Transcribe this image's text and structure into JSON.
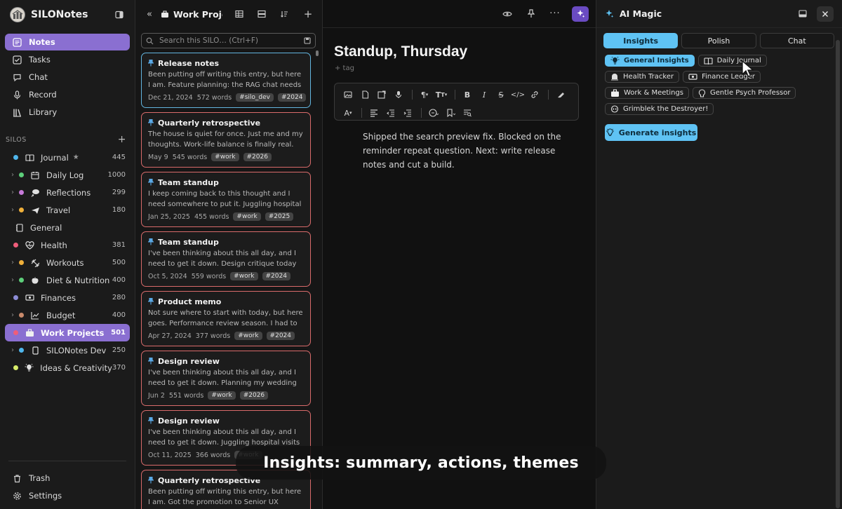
{
  "sidebar": {
    "app_title": "SILONotes",
    "nav": [
      {
        "label": "Notes",
        "icon": "notes-icon",
        "active": true
      },
      {
        "label": "Tasks",
        "icon": "checkbox-icon"
      },
      {
        "label": "Chat",
        "icon": "chat-icon"
      },
      {
        "label": "Record",
        "icon": "microphone-icon"
      },
      {
        "label": "Library",
        "icon": "library-icon"
      }
    ],
    "silos_label": "SILOS",
    "silos": [
      {
        "label": "Journal",
        "count": "445",
        "dot": "#4fb6ec",
        "icon": "book-icon",
        "star": true
      },
      {
        "label": "Daily Log",
        "count": "1000",
        "dot": "#5dcf7a",
        "icon": "calendar-icon",
        "child": true
      },
      {
        "label": "Reflections",
        "count": "299",
        "dot": "#c77ad9",
        "icon": "thought-icon",
        "child": true
      },
      {
        "label": "Travel",
        "count": "180",
        "dot": "#f0b03a",
        "icon": "plane-icon",
        "child": true
      },
      {
        "label": "General",
        "count": "",
        "dot": "",
        "icon": "notebook-icon"
      },
      {
        "label": "Health",
        "count": "381",
        "dot": "#ef5d7a",
        "icon": "heart-icon"
      },
      {
        "label": "Workouts",
        "count": "500",
        "dot": "#f0b03a",
        "icon": "dumbbell-icon",
        "child": true
      },
      {
        "label": "Diet & Nutrition",
        "count": "400",
        "dot": "#5dcf7a",
        "icon": "apple-icon",
        "child": true
      },
      {
        "label": "Finances",
        "count": "280",
        "dot": "#8c8cd6",
        "icon": "cash-icon"
      },
      {
        "label": "Budget",
        "count": "400",
        "dot": "#c98a6b",
        "icon": "chart-icon",
        "child": true
      },
      {
        "label": "Work Projects",
        "count": "501",
        "dot": "#ef5d7a",
        "icon": "briefcase-icon",
        "active": true
      },
      {
        "label": "SILONotes Dev",
        "count": "250",
        "dot": "#4fb6ec",
        "icon": "phone-icon",
        "child": true
      },
      {
        "label": "Ideas & Creativity",
        "count": "370",
        "dot": "#d8ec6a",
        "icon": "bulb-icon"
      }
    ],
    "bottom": [
      {
        "label": "Trash",
        "icon": "trash-icon"
      },
      {
        "label": "Settings",
        "icon": "gear-icon"
      }
    ]
  },
  "notes_list": {
    "title": "Work Projects",
    "search_placeholder": "Search this SILO… (Ctrl+F)",
    "cards": [
      {
        "title": "Release notes",
        "excerpt": "Been putting off writing this entry, but here I am. Feature planning: the RAG chat needs a UI...",
        "date": "Dec 21, 2024",
        "words": "572 words",
        "tags": [
          "#silo_dev",
          "#2024"
        ],
        "selected": true
      },
      {
        "title": "Quarterly retrospective",
        "excerpt": "The house is quiet for once. Just me and my thoughts. Work-life balance is finally real. I'm...",
        "date": "May 9",
        "words": "545 words",
        "tags": [
          "#work",
          "#2026"
        ]
      },
      {
        "title": "Team standup",
        "excerpt": "I keep coming back to this thought and I need somewhere to put it. Juggling hospital visits an...",
        "date": "Jan 25, 2025",
        "words": "455 words",
        "tags": [
          "#work",
          "#2025"
        ]
      },
      {
        "title": "Team standup",
        "excerpt": "I've been thinking about this all day, and I need to get it down. Design critique today was brutal in...",
        "date": "Oct 5, 2024",
        "words": "559 words",
        "tags": [
          "#work",
          "#2024"
        ]
      },
      {
        "title": "Product memo",
        "excerpt": "Not sure where to start with today, but here goes. Performance review season. I had to writ...",
        "date": "Apr 27, 2024",
        "words": "377 words",
        "tags": [
          "#work",
          "#2024"
        ]
      },
      {
        "title": "Design review",
        "excerpt": "I've been thinking about this all day, and I need to get it down. Planning my wedding leave. I want...",
        "date": "Jun 2",
        "words": "551 words",
        "tags": [
          "#work",
          "#2026"
        ]
      },
      {
        "title": "Design review",
        "excerpt": "I've been thinking about this all day, and I need to get it down. Juggling hospital visits and sprint...",
        "date": "Oct 11, 2025",
        "words": "366 words",
        "tags": [
          "#work"
        ]
      },
      {
        "title": "Quarterly retrospective",
        "excerpt": "Been putting off writing this entry, but here I am. Got the promotion to Senior UX Designer today...",
        "date": "",
        "words": "",
        "tags": []
      }
    ]
  },
  "editor": {
    "title": "Standup, Thursday",
    "tag_placeholder": "+ tag",
    "body": "Shipped the search preview fix. Blocked on the reminder repeat question. Next: write release notes and cut a build."
  },
  "ai_panel": {
    "title": "AI Magic",
    "tabs": [
      {
        "label": "Insights",
        "active": true
      },
      {
        "label": "Polish"
      },
      {
        "label": "Chat"
      }
    ],
    "chips": [
      {
        "label": "General Insights",
        "icon": "bulb-icon",
        "active": true
      },
      {
        "label": "Daily Journal",
        "icon": "book-icon"
      },
      {
        "label": "Health Tracker",
        "icon": "ambulance-icon"
      },
      {
        "label": "Finance Ledger",
        "icon": "cash-icon"
      },
      {
        "label": "Work & Meetings",
        "icon": "briefcase-icon"
      },
      {
        "label": "Gentle Psych Professor",
        "icon": "brain-icon"
      },
      {
        "label": "Grimblek the Destroyer!",
        "icon": "skull-icon"
      }
    ],
    "generate_label": "Generate insights"
  },
  "caption": "Insights: summary, actions, themes",
  "colors": {
    "accent_purple": "#8a6fd1",
    "accent_blue": "#5fc3f4",
    "card_border": "#d96b6b",
    "card_selected": "#63b6e0"
  }
}
